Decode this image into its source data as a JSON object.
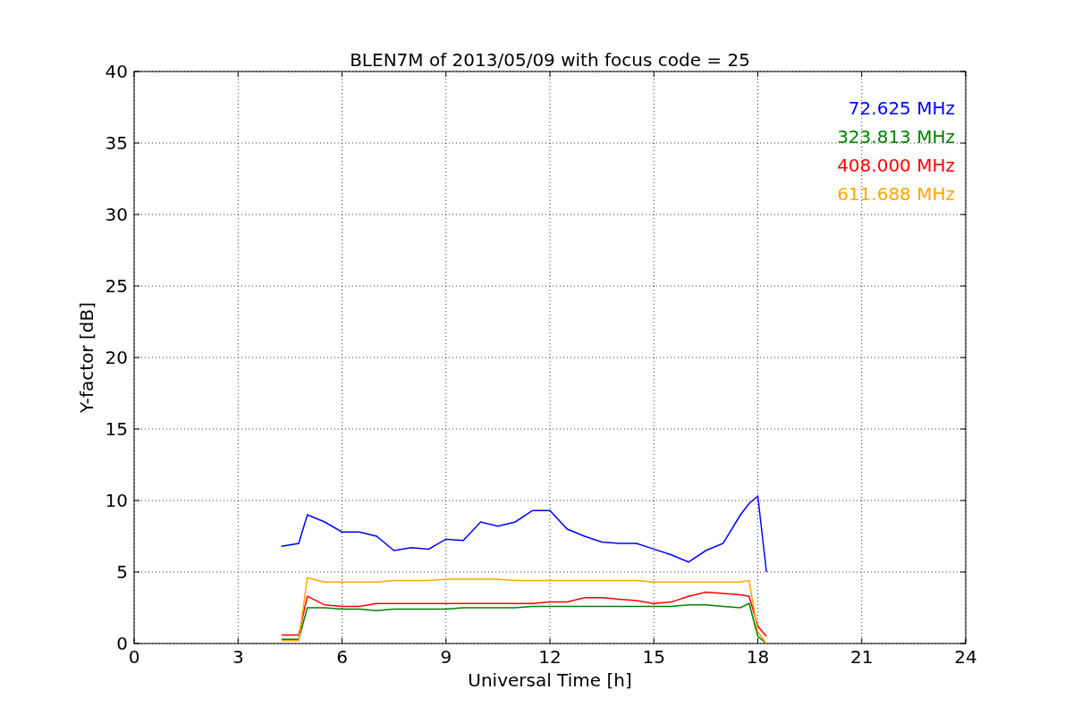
{
  "chart_data": {
    "type": "line",
    "title": "BLEN7M of 2013/05/09 with focus code = 25",
    "xlabel": "Universal Time [h]",
    "ylabel": "Y-factor [dB]",
    "x": [
      4.25,
      4.75,
      5,
      5.5,
      6,
      6.5,
      7,
      7.5,
      8,
      8.5,
      9,
      9.5,
      10,
      10.5,
      11,
      11.5,
      12,
      12.5,
      13,
      13.5,
      14,
      14.5,
      15,
      15.5,
      16,
      16.5,
      17,
      17.5,
      17.75,
      18,
      18.25
    ],
    "series": [
      {
        "name": "72.625 MHz",
        "color": "#0000ff",
        "values": [
          6.8,
          7.0,
          9,
          8.5,
          7.8,
          7.8,
          7.5,
          6.5,
          6.7,
          6.6,
          7.3,
          7.2,
          8.5,
          8.2,
          8.5,
          9.3,
          9.3,
          8,
          7.5,
          7.1,
          7.0,
          7.0,
          6.6,
          6.2,
          5.7,
          6.5,
          7.0,
          9,
          9.8,
          10.3,
          5
        ]
      },
      {
        "name": "323.813 MHz",
        "color": "#008000",
        "values": [
          0.3,
          0.3,
          2.5,
          2.5,
          2.4,
          2.4,
          2.3,
          2.4,
          2.4,
          2.4,
          2.4,
          2.5,
          2.5,
          2.5,
          2.5,
          2.6,
          2.6,
          2.6,
          2.6,
          2.6,
          2.6,
          2.6,
          2.6,
          2.6,
          2.7,
          2.7,
          2.6,
          2.5,
          2.8,
          0.5,
          0
        ]
      },
      {
        "name": "408.000 MHz",
        "color": "#ff0000",
        "values": [
          0.6,
          0.6,
          3.3,
          2.7,
          2.6,
          2.6,
          2.8,
          2.8,
          2.8,
          2.8,
          2.8,
          2.8,
          2.8,
          2.8,
          2.8,
          2.8,
          2.9,
          2.9,
          3.2,
          3.2,
          3.1,
          3.0,
          2.8,
          2.9,
          3.3,
          3.6,
          3.5,
          3.4,
          3.3,
          1.2,
          0.5
        ]
      },
      {
        "name": "611.688 MHz",
        "color": "#ffa500",
        "values": [
          0.2,
          0.2,
          4.6,
          4.3,
          4.3,
          4.3,
          4.3,
          4.4,
          4.4,
          4.4,
          4.5,
          4.5,
          4.5,
          4.5,
          4.4,
          4.4,
          4.4,
          4.4,
          4.4,
          4.4,
          4.4,
          4.4,
          4.3,
          4.3,
          4.3,
          4.3,
          4.3,
          4.3,
          4.4,
          0.8,
          0
        ]
      }
    ],
    "xlim": [
      0,
      24
    ],
    "ylim": [
      0,
      40
    ],
    "xticks": [
      0,
      3,
      6,
      9,
      12,
      15,
      18,
      21,
      24
    ],
    "yticks": [
      0,
      5,
      10,
      15,
      20,
      25,
      30,
      35,
      40
    ],
    "grid": true
  }
}
